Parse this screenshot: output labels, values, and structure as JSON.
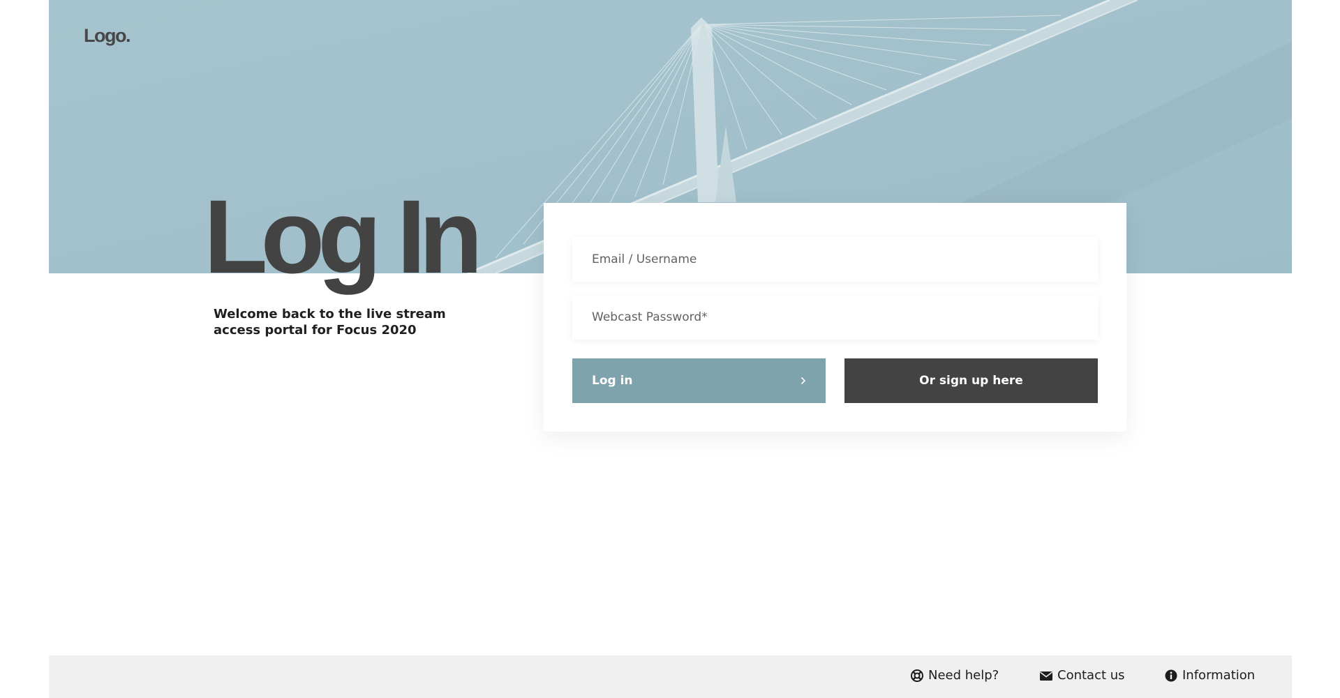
{
  "header": {
    "logo_text": "Logo."
  },
  "hero": {
    "background_color": "#a8c6d1"
  },
  "main": {
    "title": "Log In",
    "subtitle_line1": "Welcome back to the live stream",
    "subtitle_line2": "access portal for Focus 2020"
  },
  "form": {
    "email_placeholder": "Email / Username",
    "password_placeholder": "Webcast Password*",
    "login_label": "Log in",
    "signup_label": "Or sign up here",
    "login_color": "#7ea3ad",
    "signup_color": "#434343"
  },
  "footer": {
    "help_label": "Need help?",
    "contact_label": "Contact us",
    "info_label": "Information"
  }
}
